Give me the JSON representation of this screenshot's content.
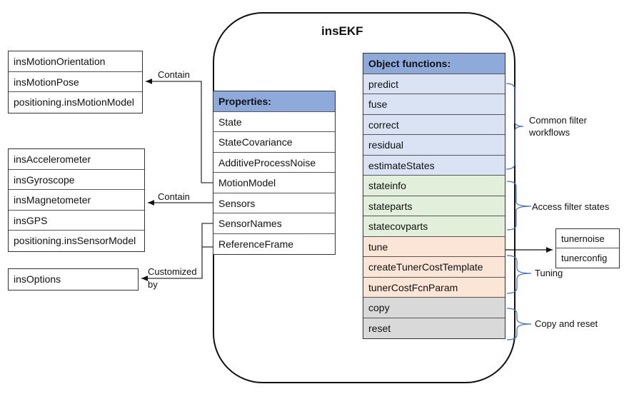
{
  "title": "insEKF",
  "motion_models": [
    "insMotionOrientation",
    "insMotionPose",
    "positioning.insMotionModel"
  ],
  "sensor_models": [
    "insAccelerometer",
    "insGyroscope",
    "insMagnetometer",
    "insGPS",
    "positioning.insSensorModel"
  ],
  "options": [
    "insOptions"
  ],
  "properties": {
    "header": "Properties:",
    "items": [
      "State",
      "StateCovariance",
      "AdditiveProcessNoise",
      "MotionModel",
      "Sensors",
      "SensorNames",
      "ReferenceFrame"
    ]
  },
  "object_functions": {
    "header": "Object functions:",
    "groups": [
      {
        "name": "common",
        "color": "#dae3f3",
        "items": [
          "predict",
          "fuse",
          "correct",
          "residual",
          "estimateStates"
        ]
      },
      {
        "name": "access",
        "color": "#e2efda",
        "items": [
          "stateinfo",
          "stateparts",
          "statecovparts"
        ]
      },
      {
        "name": "tuning",
        "color": "#fbe5d6",
        "items": [
          "tune",
          "createTunerCostTemplate",
          "tunerCostFcnParam"
        ]
      },
      {
        "name": "copyreset",
        "color": "#d9d9d9",
        "items": [
          "copy",
          "reset"
        ]
      }
    ]
  },
  "tuner_outputs": [
    "tunernoise",
    "tunerconfig"
  ],
  "arrow_labels": {
    "contain_motion": "Contain",
    "contain_sensors": "Contain",
    "customized_1": "Customized",
    "customized_2": "by"
  },
  "brace_labels": {
    "common_1": "Common filter",
    "common_2": "workflows",
    "access": "Access filter states",
    "tuning": "Tuning",
    "copyreset": "Copy and reset"
  },
  "colors": {
    "header": "#8eaadb",
    "brace": "#4472c4"
  }
}
